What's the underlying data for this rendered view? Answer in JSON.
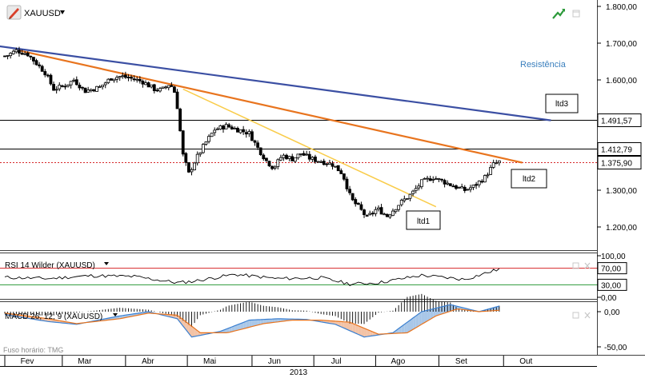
{
  "header": {
    "symbol": "XAUUSD",
    "dropdown_icon": "triangle-down-icon",
    "symbol_icon": "pencil-icon",
    "maximize_icon": "chart-trend-icon",
    "restore_icon": "window-restore-icon"
  },
  "timezone_label": "Fuso horário: TMG",
  "year_label": "2013",
  "month_labels": [
    "Fev",
    "Mar",
    "Abr",
    "Mai",
    "Jun",
    "Jul",
    "Ago",
    "Set",
    "Out"
  ],
  "chart_data": [
    {
      "type": "candlestick",
      "title": "XAUUSD",
      "ylim": [
        1150,
        1810
      ],
      "yticks": [
        "1.800,00",
        "1.700,00",
        "1.600,00",
        "1.500,00",
        "1.400,00",
        "1.300,00",
        "1.200,00"
      ],
      "yticks_values": [
        1800,
        1700,
        1600,
        1500,
        1400,
        1300,
        1200
      ],
      "x_range_weeks": [
        0,
        41.2
      ],
      "close_anchors": [
        [
          0.1,
          1665
        ],
        [
          0.8,
          1680
        ],
        [
          1.6,
          1670
        ],
        [
          2.2,
          1645
        ],
        [
          2.8,
          1620
        ],
        [
          3.4,
          1575
        ],
        [
          4.2,
          1585
        ],
        [
          4.8,
          1600
        ],
        [
          5.6,
          1570
        ],
        [
          6.6,
          1580
        ],
        [
          7.4,
          1605
        ],
        [
          8.1,
          1610
        ],
        [
          8.9,
          1603
        ],
        [
          9.6,
          1595
        ],
        [
          10.4,
          1575
        ],
        [
          10.9,
          1572
        ],
        [
          11.5,
          1590
        ],
        [
          11.9,
          1560
        ],
        [
          12.4,
          1395
        ],
        [
          12.8,
          1345
        ],
        [
          13.3,
          1385
        ],
        [
          13.9,
          1425
        ],
        [
          14.6,
          1465
        ],
        [
          15.4,
          1475
        ],
        [
          16.2,
          1465
        ],
        [
          17.0,
          1455
        ],
        [
          17.6,
          1415
        ],
        [
          18.2,
          1380
        ],
        [
          18.7,
          1360
        ],
        [
          19.3,
          1395
        ],
        [
          20.0,
          1385
        ],
        [
          20.6,
          1400
        ],
        [
          21.3,
          1385
        ],
        [
          22.1,
          1378
        ],
        [
          22.8,
          1370
        ],
        [
          23.5,
          1345
        ],
        [
          24.1,
          1275
        ],
        [
          24.6,
          1255
        ],
        [
          25.2,
          1225
        ],
        [
          25.9,
          1250
        ],
        [
          26.6,
          1230
        ],
        [
          27.5,
          1265
        ],
        [
          28.3,
          1290
        ],
        [
          29.0,
          1322
        ],
        [
          29.8,
          1335
        ],
        [
          30.6,
          1322
        ],
        [
          31.3,
          1310
        ],
        [
          32.0,
          1300
        ],
        [
          32.6,
          1310
        ],
        [
          33.4,
          1335
        ],
        [
          34.0,
          1370
        ],
        [
          34.4,
          1377
        ]
      ],
      "last_price": "1.375,90",
      "horizontal_levels": [
        {
          "value": 1491.57,
          "label": "1.491,57"
        },
        {
          "value": 1412.79,
          "label": "1.412,79"
        }
      ],
      "trendlines": [
        {
          "name": "ltd1",
          "label": "ltd1",
          "color": "#f9cc4a",
          "from": [
            12.4,
            1575
          ],
          "to": [
            30.0,
            1255
          ]
        },
        {
          "name": "ltd2",
          "label": "ltd2",
          "color": "#e8741e",
          "from": [
            1.0,
            1680
          ],
          "to": [
            36.0,
            1375
          ]
        },
        {
          "name": "ltd3",
          "label": "ltd3",
          "color": "#3b4fa3",
          "from": [
            -2.0,
            1700
          ],
          "to": [
            38.0,
            1490
          ]
        }
      ],
      "annotation": "Resistência"
    },
    {
      "type": "line",
      "title": "RSI 14 Wilder (XAUUSD)",
      "ylim": [
        0,
        100
      ],
      "yticks": [
        "100,00",
        "70,00",
        "30,00",
        "0,00"
      ],
      "yticks_values": [
        100,
        70,
        30,
        0
      ],
      "levels": [
        70,
        30
      ],
      "values_anchors": [
        [
          0,
          48
        ],
        [
          3,
          45
        ],
        [
          6,
          52
        ],
        [
          9,
          50
        ],
        [
          12,
          35
        ],
        [
          13,
          38
        ],
        [
          16,
          55
        ],
        [
          19,
          45
        ],
        [
          22,
          47
        ],
        [
          24,
          32
        ],
        [
          26,
          35
        ],
        [
          29,
          53
        ],
        [
          32,
          43
        ],
        [
          34.4,
          68
        ]
      ]
    },
    {
      "type": "histogram+lines",
      "title": "MACD 26; 12; 9 (XAUUSD)",
      "ylim": [
        -55,
        18
      ],
      "yticks": [
        "0,00",
        "-50,00"
      ],
      "yticks_values": [
        0,
        -50
      ],
      "macd_anchors": [
        [
          0,
          -4
        ],
        [
          3,
          -14
        ],
        [
          5,
          -18
        ],
        [
          8,
          -6
        ],
        [
          10,
          0
        ],
        [
          12,
          -10
        ],
        [
          13,
          -36
        ],
        [
          15,
          -28
        ],
        [
          17,
          -12
        ],
        [
          19,
          -10
        ],
        [
          21,
          -11
        ],
        [
          23,
          -18
        ],
        [
          25,
          -36
        ],
        [
          27,
          -30
        ],
        [
          29,
          0
        ],
        [
          31,
          10
        ],
        [
          33,
          0
        ],
        [
          34.4,
          8
        ]
      ],
      "signal_anchors": [
        [
          0,
          -2
        ],
        [
          3,
          -10
        ],
        [
          5,
          -17
        ],
        [
          8,
          -10
        ],
        [
          10,
          -2
        ],
        [
          12,
          -5
        ],
        [
          13.6,
          -30
        ],
        [
          15.5,
          -30
        ],
        [
          18,
          -17
        ],
        [
          20,
          -12
        ],
        [
          22,
          -12
        ],
        [
          24,
          -15
        ],
        [
          26,
          -32
        ],
        [
          28,
          -30
        ],
        [
          30,
          -6
        ],
        [
          31.5,
          4
        ],
        [
          33,
          0
        ],
        [
          34.4,
          2
        ]
      ]
    }
  ]
}
